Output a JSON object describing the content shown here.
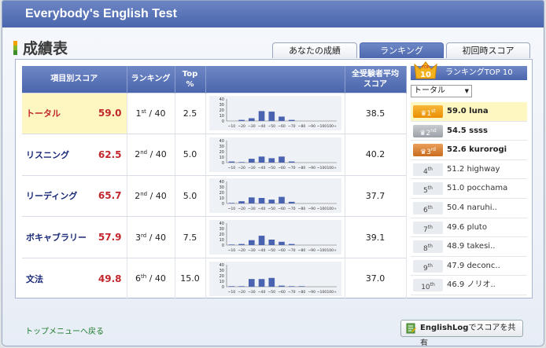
{
  "window": {
    "title": "Everybody's English Test"
  },
  "page": {
    "title": "成績表"
  },
  "tabs": [
    {
      "label": "あなたの成績",
      "active": false
    },
    {
      "label": "ランキング",
      "active": true
    },
    {
      "label": "初回時スコア",
      "active": false
    }
  ],
  "table": {
    "headers": {
      "category": "項目別スコア",
      "ranking": "ランキング",
      "top_line1": "Top",
      "top_line2": "%",
      "avg_line1": "全受験者平均",
      "avg_line2": "スコア"
    },
    "rows": [
      {
        "name": "トータル",
        "score": "59.0",
        "rank": "1",
        "rank_suffix": "st",
        "rank_total": "/ 40",
        "top_percent": "2.5",
        "average": "38.5",
        "histogram": [
          0,
          2,
          5,
          18,
          17,
          8,
          2,
          0,
          0,
          0,
          0
        ]
      },
      {
        "name": "リスニング",
        "score": "62.5",
        "rank": "2",
        "rank_suffix": "nd",
        "rank_total": "/ 40",
        "top_percent": "5.0",
        "average": "40.2",
        "histogram": [
          2,
          1,
          7,
          11,
          8,
          11,
          2,
          0,
          0,
          0,
          0
        ]
      },
      {
        "name": "リーディング",
        "score": "65.7",
        "rank": "2",
        "rank_suffix": "nd",
        "rank_total": "/ 40",
        "top_percent": "5.0",
        "average": "37.7",
        "histogram": [
          1,
          4,
          11,
          10,
          7,
          12,
          3,
          0,
          0,
          0,
          0
        ]
      },
      {
        "name": "ボキャブラリー",
        "score": "57.9",
        "rank": "3",
        "rank_suffix": "rd",
        "rank_total": "/ 40",
        "top_percent": "7.5",
        "average": "39.1",
        "histogram": [
          1,
          2,
          9,
          17,
          10,
          6,
          2,
          0,
          0,
          0,
          0
        ]
      },
      {
        "name": "文法",
        "score": "49.8",
        "rank": "6",
        "rank_suffix": "th",
        "rank_total": "/ 40",
        "top_percent": "15.0",
        "average": "37.0",
        "histogram": [
          1,
          1,
          14,
          14,
          16,
          2,
          1,
          1,
          0,
          0,
          0
        ]
      }
    ],
    "histogram_axis": {
      "y_ticks": [
        "40",
        "30",
        "20",
        "10",
        "0"
      ],
      "x_ticks": [
        "~10",
        "~20",
        "~30",
        "~40",
        "~50",
        "~60",
        "~70",
        "~80",
        "~90",
        "~100",
        "100+"
      ],
      "ylim": [
        0,
        40
      ]
    }
  },
  "ranking": {
    "header": "ランキングTOP 10",
    "badge_top": "TOP",
    "badge_num": "10",
    "selected": "トータル",
    "items": [
      {
        "rank": "1",
        "suffix": "st",
        "text": "59.0 luna",
        "style": "gold"
      },
      {
        "rank": "2",
        "suffix": "nd",
        "text": "54.5 ssss",
        "style": "silver"
      },
      {
        "rank": "3",
        "suffix": "rd",
        "text": "52.6 kurorogi",
        "style": "bronze"
      },
      {
        "rank": "4",
        "suffix": "th",
        "text": "51.2 highway",
        "style": "plain"
      },
      {
        "rank": "5",
        "suffix": "th",
        "text": "51.0 pocchama",
        "style": "plain"
      },
      {
        "rank": "6",
        "suffix": "th",
        "text": "50.4 naruhi..",
        "style": "plain"
      },
      {
        "rank": "7",
        "suffix": "th",
        "text": "49.6 pluto",
        "style": "plain"
      },
      {
        "rank": "8",
        "suffix": "th",
        "text": "48.9 takesi..",
        "style": "plain"
      },
      {
        "rank": "9",
        "suffix": "th",
        "text": "47.9 deconc..",
        "style": "plain"
      },
      {
        "rank": "10",
        "suffix": "th",
        "text": "46.9 ノリオ..",
        "style": "plain"
      }
    ]
  },
  "footer": {
    "back_link": "トップメニューへ戻る",
    "share_brand": "EnglishLog",
    "share_rest": "でスコアを共有"
  },
  "colors": {
    "header_blue": "#4b66ad",
    "score_red": "#c1272d",
    "highlight_yellow": "#fff7c2",
    "bar_blue": "#4a63b0"
  }
}
